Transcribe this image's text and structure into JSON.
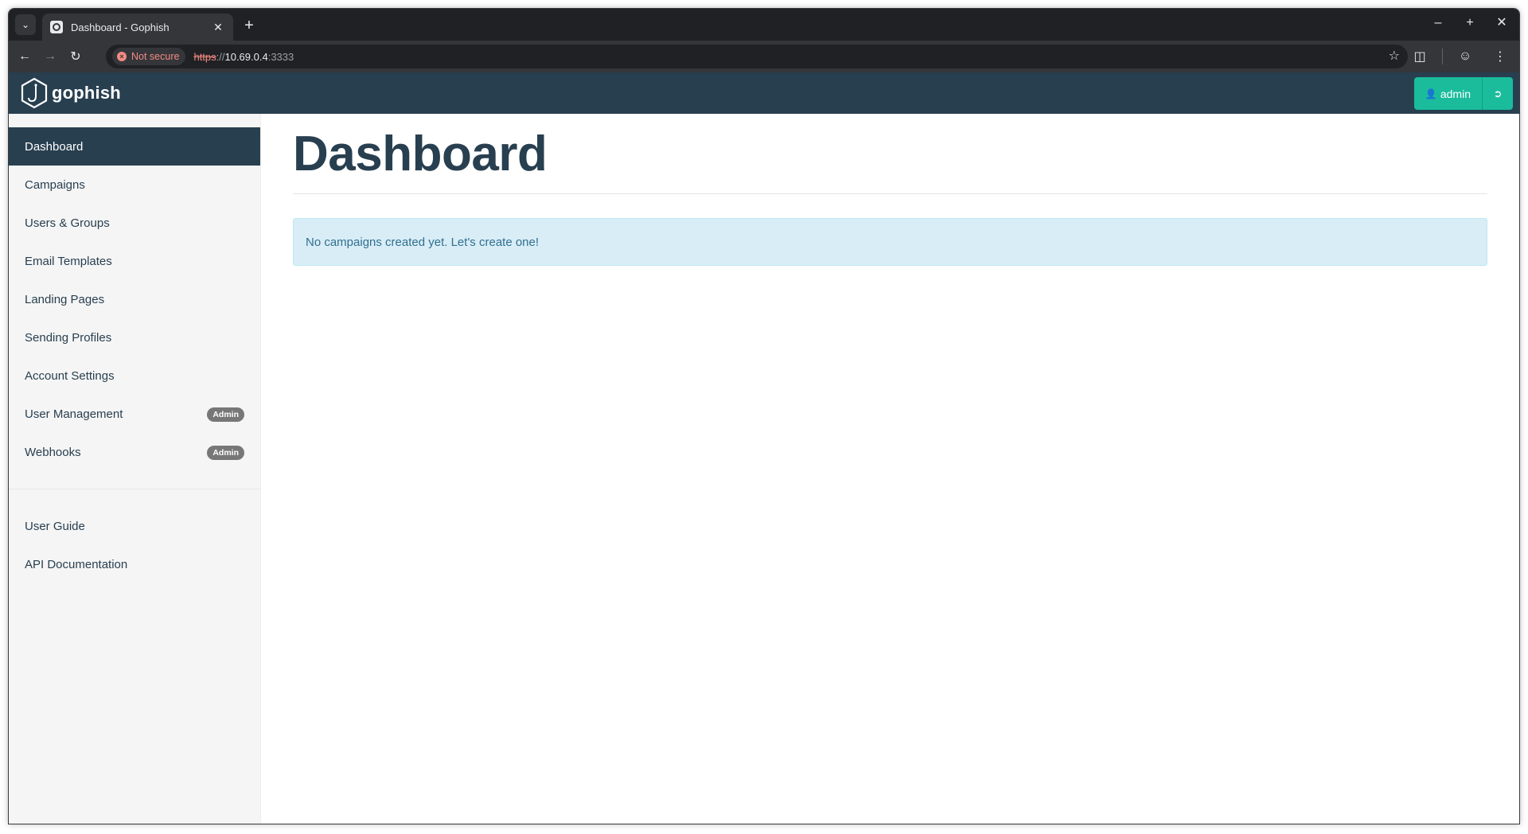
{
  "browser": {
    "tab_title": "Dashboard - Gophish",
    "new_tab_label": "+",
    "security_label": "Not secure",
    "url_scheme": "https",
    "url_sep": "://",
    "url_host": "10.69.0.4",
    "url_port": ":3333"
  },
  "navbar": {
    "brand": "gophish",
    "user_label": "admin"
  },
  "sidebar": {
    "items": [
      {
        "label": "Dashboard"
      },
      {
        "label": "Campaigns"
      },
      {
        "label": "Users & Groups"
      },
      {
        "label": "Email Templates"
      },
      {
        "label": "Landing Pages"
      },
      {
        "label": "Sending Profiles"
      },
      {
        "label": "Account Settings"
      },
      {
        "label": "User Management",
        "badge": "Admin"
      },
      {
        "label": "Webhooks",
        "badge": "Admin"
      }
    ],
    "help_items": [
      {
        "label": "User Guide"
      },
      {
        "label": "API Documentation"
      }
    ]
  },
  "main": {
    "title": "Dashboard",
    "empty_message": "No campaigns created yet. Let's create one!"
  },
  "colors": {
    "navbar_bg": "#283f50",
    "accent": "#1abc9c",
    "alert_bg": "#d9edf7",
    "alert_text": "#31708f"
  }
}
